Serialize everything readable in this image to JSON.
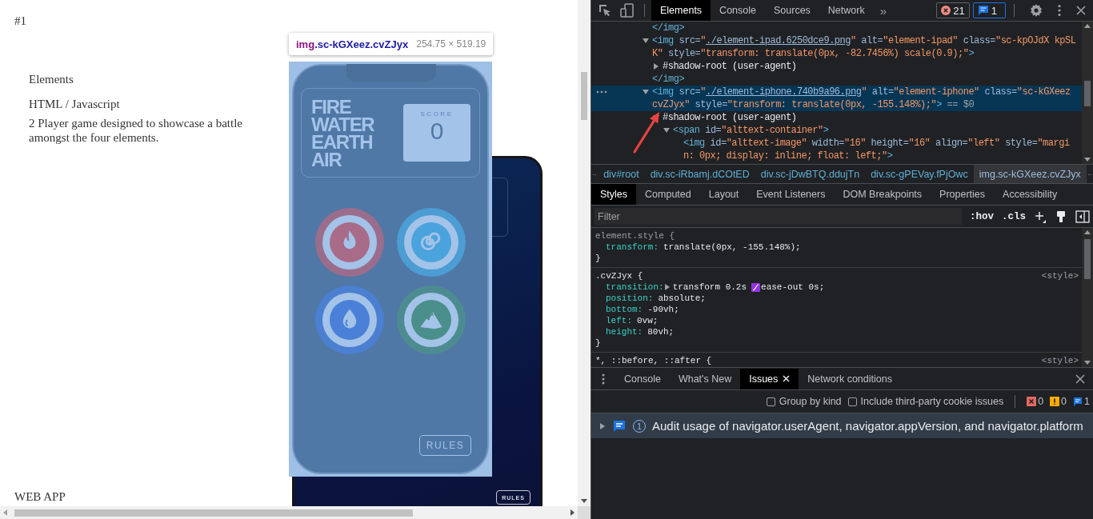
{
  "page": {
    "heading": "#1",
    "project": {
      "title": "Elements",
      "tech": "HTML / Javascript",
      "description": "2 Player game designed to showcase a battle amongst the four elements."
    },
    "footer": "WEB APP"
  },
  "inspect_tooltip": {
    "tag": "img",
    "classes": ".sc-kGXeez.cvZJyx",
    "size": "254.75 × 519.19"
  },
  "phone": {
    "title_lines": [
      "FIRE",
      "WATER",
      "EARTH",
      "AIR"
    ],
    "score_label": "SCORE",
    "score": "0",
    "rules_button": "RULES",
    "elements": [
      {
        "kind": "flame",
        "color": "#a86b88"
      },
      {
        "kind": "spiral",
        "color": "#4aa3dc"
      },
      {
        "kind": "drop",
        "color": "#4a80d8"
      },
      {
        "kind": "mountain",
        "color": "#4b8f8d"
      }
    ]
  },
  "tablet": {
    "rules_button": "RULES"
  },
  "devtools": {
    "tabs": [
      {
        "label": "Elements",
        "selected": true
      },
      {
        "label": "Console",
        "selected": false
      },
      {
        "label": "Sources",
        "selected": false
      },
      {
        "label": "Network",
        "selected": false
      }
    ],
    "more": "»",
    "error_count": "21",
    "message_count": "1",
    "dom_tree": [
      {
        "parts": [
          {
            "kind": "tag",
            "text": "</img>"
          }
        ],
        "selected": false
      },
      {
        "parts": [
          {
            "kind": "tag",
            "text": "<img"
          },
          {
            "kind": "attr",
            "text": " src="
          },
          {
            "kind": "value",
            "text": "\""
          },
          {
            "kind": "link",
            "text": "./element-ipad.6250dce9.png"
          },
          {
            "kind": "value",
            "text": "\""
          },
          {
            "kind": "attr",
            "text": " alt="
          },
          {
            "kind": "value",
            "text": "\"element-ipad\""
          },
          {
            "kind": "attr",
            "text": " class="
          },
          {
            "kind": "value",
            "text": "\"sc-kpOJdX kpSLK\""
          },
          {
            "kind": "attr",
            "text": " style="
          },
          {
            "kind": "value",
            "text": "\"transform: translate(0px, -82.7456%) scale(0.9);\""
          },
          {
            "kind": "tag",
            "text": ">"
          }
        ],
        "selected": false,
        "expanded": true,
        "children": [
          {
            "parts": [
              {
                "kind": "text",
                "text": "#shadow-root (user-agent)"
              }
            ],
            "selected": false,
            "expanded": false
          }
        ]
      },
      {
        "parts": [
          {
            "kind": "tag",
            "text": "</img>"
          }
        ],
        "selected": false
      },
      {
        "parts": [
          {
            "kind": "tag",
            "text": "<img"
          },
          {
            "kind": "attr",
            "text": " src="
          },
          {
            "kind": "value",
            "text": "\""
          },
          {
            "kind": "link",
            "text": "./element-iphone.740b9a96.png"
          },
          {
            "kind": "value",
            "text": "\""
          },
          {
            "kind": "attr",
            "text": " alt="
          },
          {
            "kind": "value",
            "text": "\"element-iphone\""
          },
          {
            "kind": "attr",
            "text": " class="
          },
          {
            "kind": "value",
            "text": "\"sc-kGXeez cvZJyx\""
          },
          {
            "kind": "attr",
            "text": " style="
          },
          {
            "kind": "value",
            "text": "\"transform: translate(0px, -155.148%);\""
          },
          {
            "kind": "tag",
            "text": ">"
          },
          {
            "kind": "marker",
            "text": " == $0"
          }
        ],
        "selected": true,
        "expanded": true,
        "children": [
          {
            "parts": [
              {
                "kind": "text",
                "text": "#shadow-root (user-agent)"
              }
            ],
            "selected": false,
            "expanded": true,
            "children": [
              {
                "parts": [
                  {
                    "kind": "tag",
                    "text": "<span"
                  },
                  {
                    "kind": "attr",
                    "text": " id="
                  },
                  {
                    "kind": "value",
                    "text": "\"alttext-container\""
                  },
                  {
                    "kind": "tag",
                    "text": ">"
                  }
                ],
                "selected": false,
                "expanded": true,
                "children": [
                  {
                    "parts": [
                      {
                        "kind": "tag",
                        "text": "<img"
                      },
                      {
                        "kind": "attr",
                        "text": " id="
                      },
                      {
                        "kind": "value",
                        "text": "\"alttext-image\""
                      },
                      {
                        "kind": "attr",
                        "text": " width="
                      },
                      {
                        "kind": "value",
                        "text": "\"16\""
                      },
                      {
                        "kind": "attr",
                        "text": " height="
                      },
                      {
                        "kind": "value",
                        "text": "\"16\""
                      },
                      {
                        "kind": "attr",
                        "text": " align="
                      },
                      {
                        "kind": "value",
                        "text": "\"left\""
                      },
                      {
                        "kind": "attr",
                        "text": " style="
                      },
                      {
                        "kind": "value",
                        "text": "\"margin: 0px; display: inline; float: left;\""
                      },
                      {
                        "kind": "tag",
                        "text": ">"
                      }
                    ],
                    "selected": false
                  }
                ]
              }
            ]
          }
        ]
      }
    ],
    "breadcrumbs": [
      {
        "label": "div#root",
        "selected": false
      },
      {
        "label": "div.sc-iRbamj.dCOtED",
        "selected": false
      },
      {
        "label": "div.sc-jDwBTQ.ddujTn",
        "selected": false
      },
      {
        "label": "div.sc-gPEVay.fPjOwc",
        "selected": false
      },
      {
        "label": "img.sc-kGXeez.cvZJyx",
        "selected": true
      }
    ],
    "styles_tabs": [
      {
        "label": "Styles",
        "selected": true
      },
      {
        "label": "Computed",
        "selected": false
      },
      {
        "label": "Layout",
        "selected": false
      },
      {
        "label": "Event Listeners",
        "selected": false
      },
      {
        "label": "DOM Breakpoints",
        "selected": false
      },
      {
        "label": "Properties",
        "selected": false
      },
      {
        "label": "Accessibility",
        "selected": false
      }
    ],
    "filter": {
      "placeholder": "Filter"
    },
    "style_buttons": [
      ":hov",
      ".cls"
    ],
    "rules": [
      {
        "kind": "inline",
        "selector": "element.style {",
        "declarations": [
          {
            "property": "transform:",
            "value": "translate(0px, -155.148%);"
          }
        ],
        "close": "}"
      },
      {
        "kind": "rule",
        "selector": ".cvZJyx {",
        "source": "<style>",
        "declarations": [
          {
            "property": "transition:",
            "value": "transform 0.2s",
            "expandable": true,
            "easing": "ease-out 0s;"
          },
          {
            "property": "position:",
            "value": "absolute;"
          },
          {
            "property": "bottom:",
            "value": "-90vh;"
          },
          {
            "property": "left:",
            "value": "0vw;"
          },
          {
            "property": "height:",
            "value": "80vh;"
          }
        ],
        "close": "}"
      },
      {
        "kind": "rule",
        "selector": "*, ::before, ::after {",
        "source": "<style>"
      }
    ]
  },
  "drawer": {
    "tabs": [
      {
        "label": "Console",
        "selected": false
      },
      {
        "label": "What's New",
        "selected": false
      },
      {
        "label": "Issues",
        "selected": true,
        "closable": true
      },
      {
        "label": "Network conditions",
        "selected": false
      }
    ],
    "options": [
      {
        "label": "Group by kind",
        "checked": false
      },
      {
        "label": "Include third-party cookie issues",
        "checked": false
      }
    ],
    "counts": {
      "errors": "0",
      "warnings": "0",
      "info": "1"
    },
    "issues": [
      {
        "count": "1",
        "text": "Audit usage of navigator.userAgent, navigator.appVersion, and navigator.platform",
        "expanded": false
      }
    ]
  }
}
